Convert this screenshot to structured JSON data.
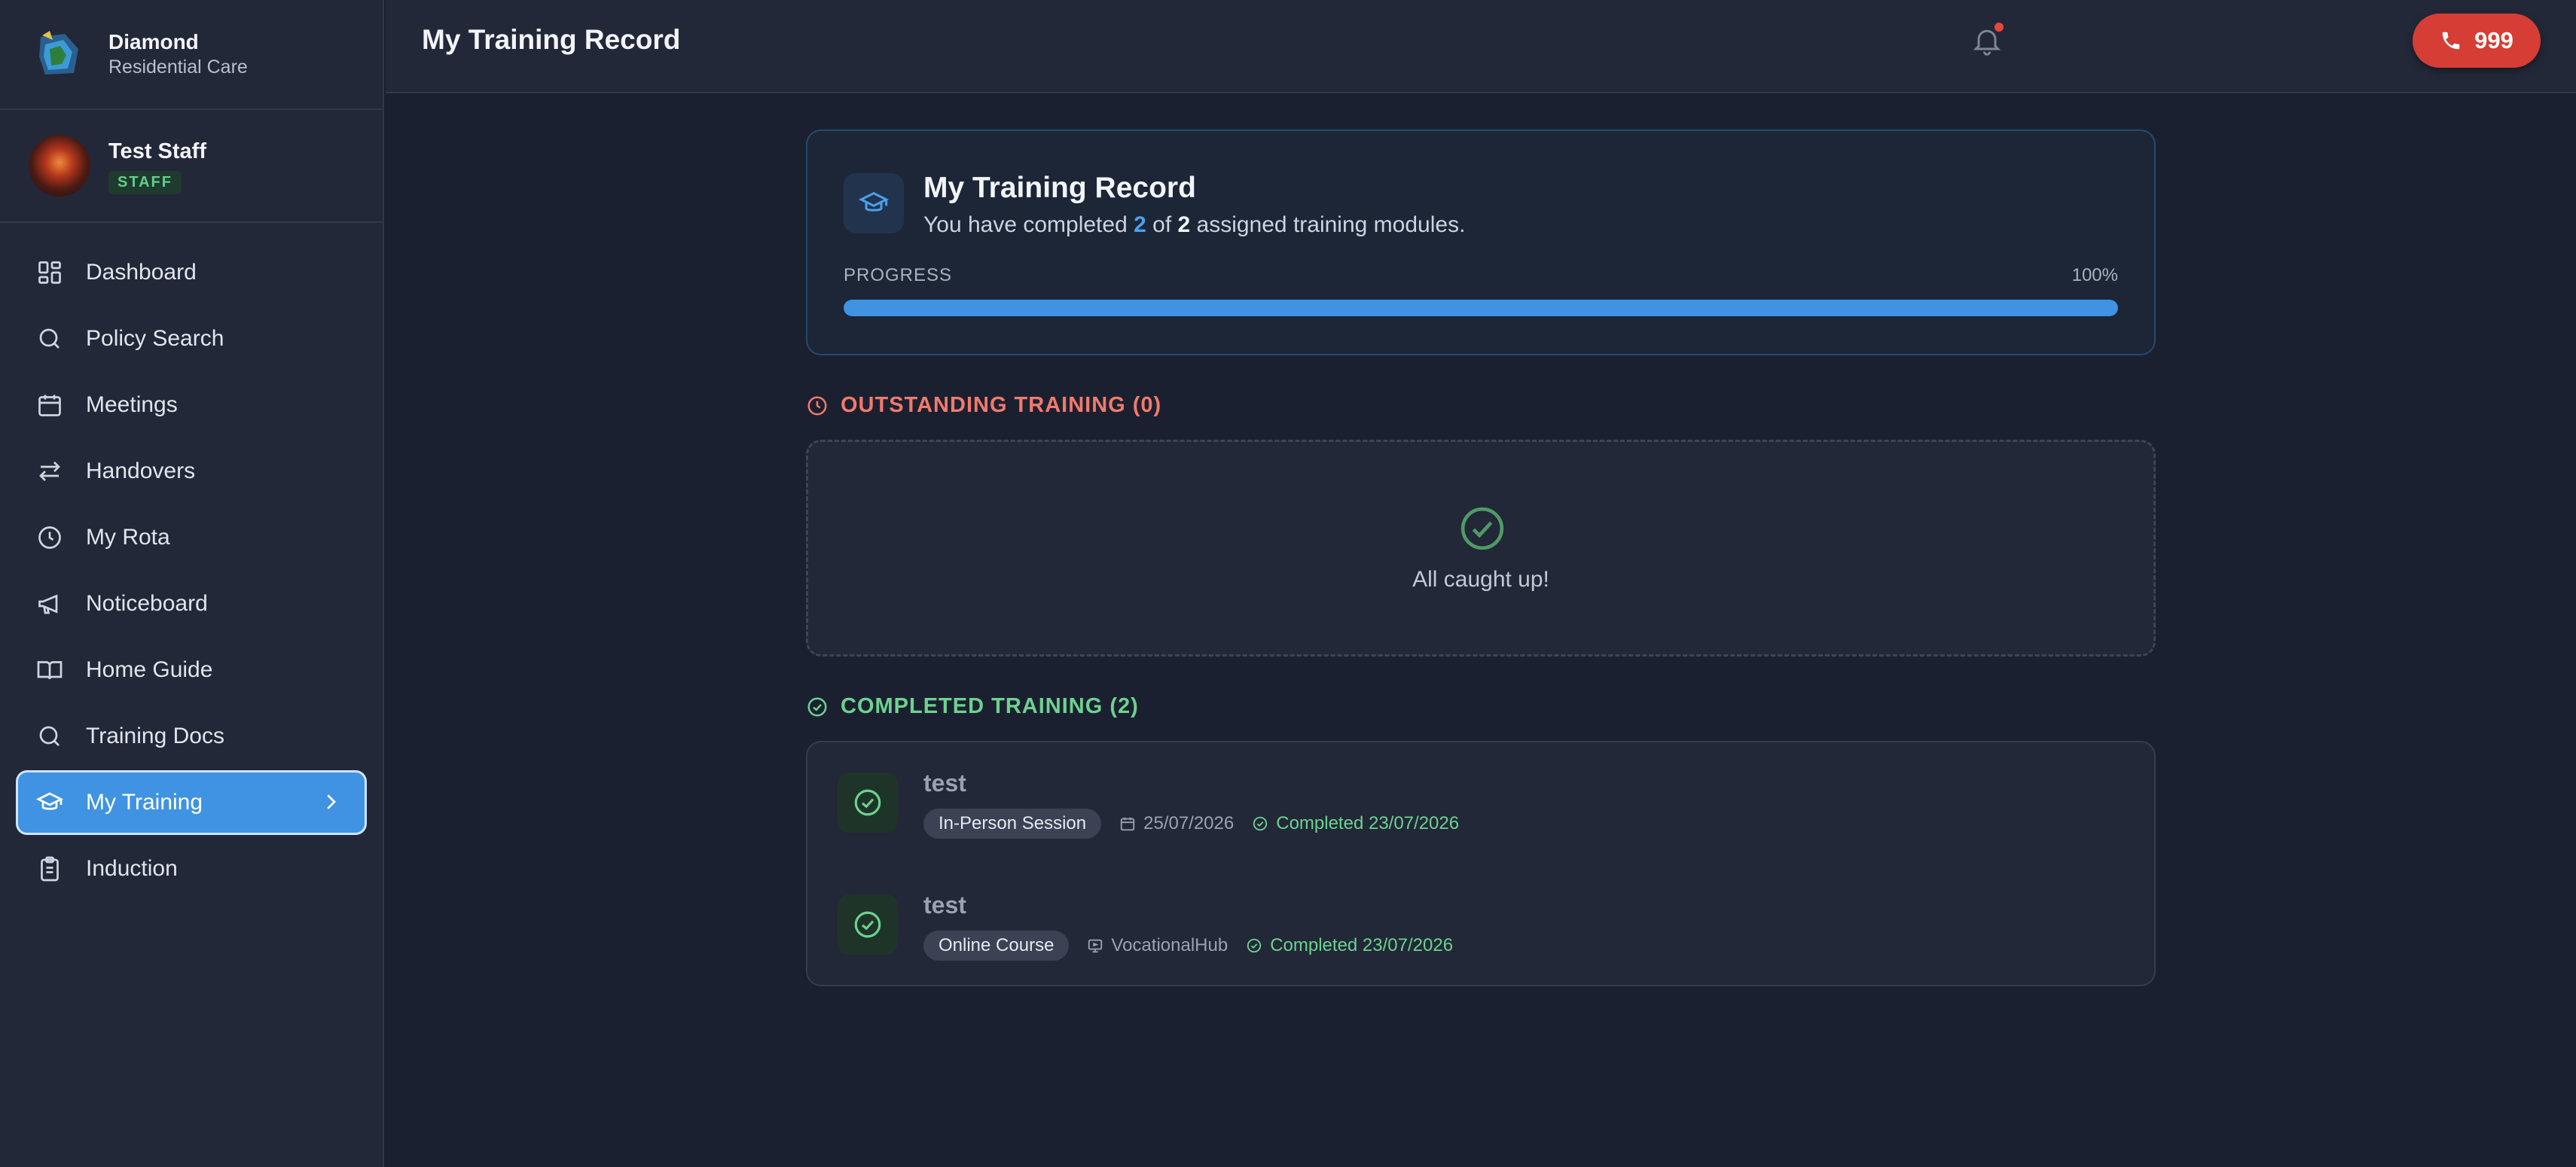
{
  "brand": {
    "name": "Diamond",
    "subtitle": "Residential Care"
  },
  "user": {
    "name": "Test Staff",
    "role": "STAFF"
  },
  "nav": {
    "items": [
      {
        "label": "Dashboard",
        "icon": "dashboard-icon"
      },
      {
        "label": "Policy Search",
        "icon": "search-icon"
      },
      {
        "label": "Meetings",
        "icon": "calendar-icon"
      },
      {
        "label": "Handovers",
        "icon": "swap-arrows-icon"
      },
      {
        "label": "My Rota",
        "icon": "clock-icon"
      },
      {
        "label": "Noticeboard",
        "icon": "megaphone-icon"
      },
      {
        "label": "Home Guide",
        "icon": "book-icon"
      },
      {
        "label": "Training Docs",
        "icon": "search-icon"
      },
      {
        "label": "My Training",
        "icon": "graduation-cap-icon",
        "active": true
      },
      {
        "label": "Induction",
        "icon": "clipboard-icon"
      }
    ]
  },
  "header": {
    "title": "My Training Record",
    "emergency_label": "999"
  },
  "summary": {
    "title": "My Training Record",
    "text_prefix": "You have completed ",
    "completed": "2",
    "text_mid": " of ",
    "assigned": "2",
    "text_suffix": " assigned training modules.",
    "progress_label": "PROGRESS",
    "progress_pct_text": "100%",
    "progress_fraction": 1.0
  },
  "outstanding": {
    "title": "OUTSTANDING TRAINING (0)",
    "empty_text": "All caught up!"
  },
  "completed_section": {
    "title": "COMPLETED TRAINING (2)",
    "items": [
      {
        "title": "test",
        "type": "In-Person Session",
        "detail": "25/07/2026",
        "detail_icon": "calendar-icon",
        "status": "Completed 23/07/2026"
      },
      {
        "title": "test",
        "type": "Online Course",
        "detail": "VocationalHub",
        "detail_icon": "monitor-icon",
        "status": "Completed 23/07/2026"
      }
    ]
  },
  "colors": {
    "accent": "#3f93e2",
    "danger": "#d63d35",
    "success": "#6dd28f",
    "warning": "#f07a6c"
  }
}
